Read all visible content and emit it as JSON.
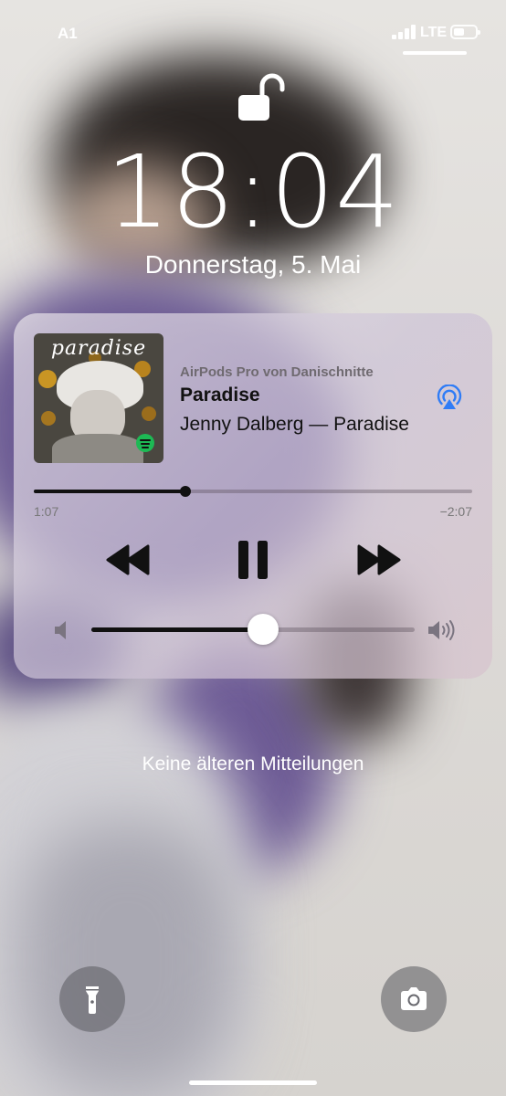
{
  "status_bar": {
    "carrier": "A1",
    "network": "LTE",
    "signal_bars": 4,
    "battery_percent": 35
  },
  "lock_screen": {
    "time": "18:04",
    "date": "Donnerstag, 5. Mai",
    "lock_state": "unlocked"
  },
  "now_playing": {
    "album_art_text": "paradise",
    "device": "AirPods Pro von Danischnitte",
    "title": "Paradise",
    "artist_album": "Jenny Dalberg — Paradise",
    "elapsed": "1:07",
    "remaining": "−2:07",
    "progress": 0.345,
    "volume": 0.53,
    "icons": [
      "rewind-icon",
      "pause-icon",
      "fast-forward-icon",
      "airplay-icon",
      "volume-low-icon",
      "volume-high-icon",
      "spotify-icon"
    ]
  },
  "notifications": {
    "empty_text": "Keine älteren Mitteilungen"
  },
  "quick_actions": [
    "flashlight",
    "camera"
  ],
  "colors": {
    "accent_airplay": "#2f7cf6",
    "spotify": "#1db954"
  }
}
